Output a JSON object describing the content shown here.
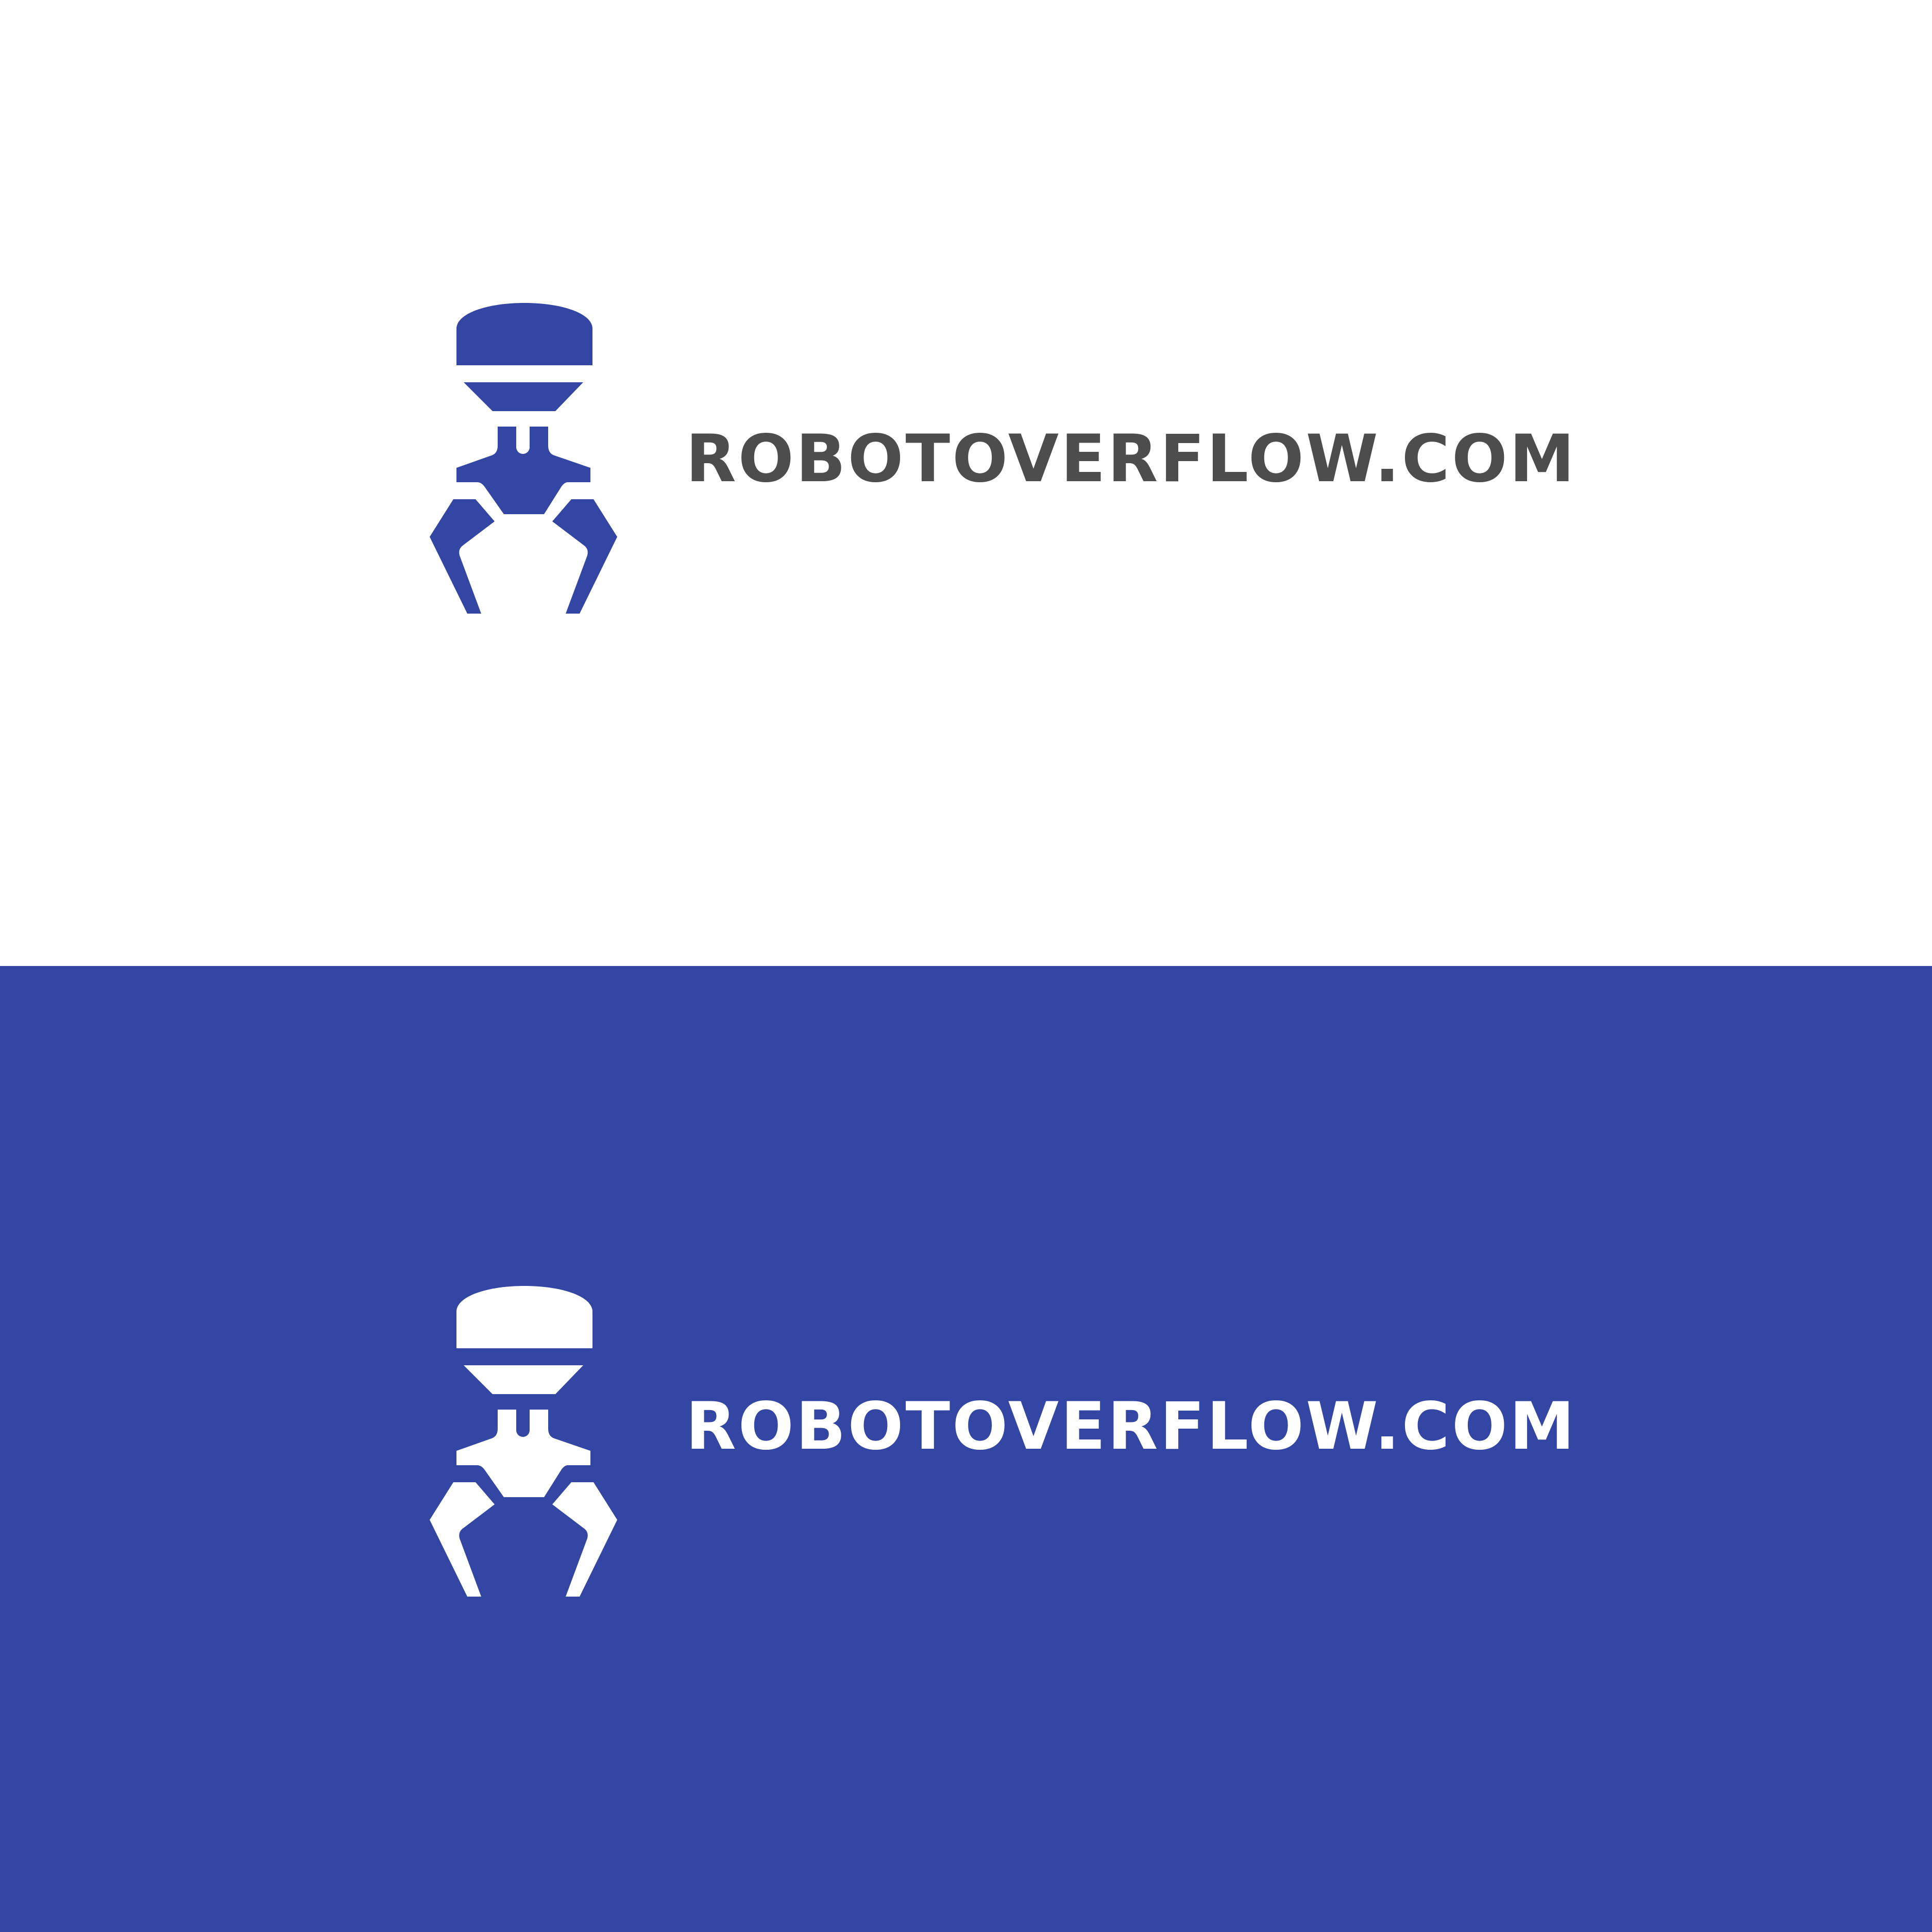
{
  "colors": {
    "brand_blue": "#3446a3",
    "dark_gray": "#4d4d4d",
    "white": "#ffffff"
  },
  "palette": [
    {
      "name": "brand-blue",
      "hex": "#3446a3"
    },
    {
      "name": "dark-gray",
      "hex": "#4d4d4d"
    }
  ],
  "logos": [
    {
      "variant": "on-white",
      "background": "#ffffff",
      "icon_color": "#3446a3",
      "text_color": "#4d4d4d",
      "wordmark": "ROBOTOVERFLOW.COM"
    },
    {
      "variant": "on-blue",
      "background": "#3446a3",
      "icon_color": "#ffffff",
      "text_color": "#ffffff",
      "wordmark": "ROBOTOVERFLOW.COM"
    }
  ],
  "icon_name": "robot-claw-icon"
}
